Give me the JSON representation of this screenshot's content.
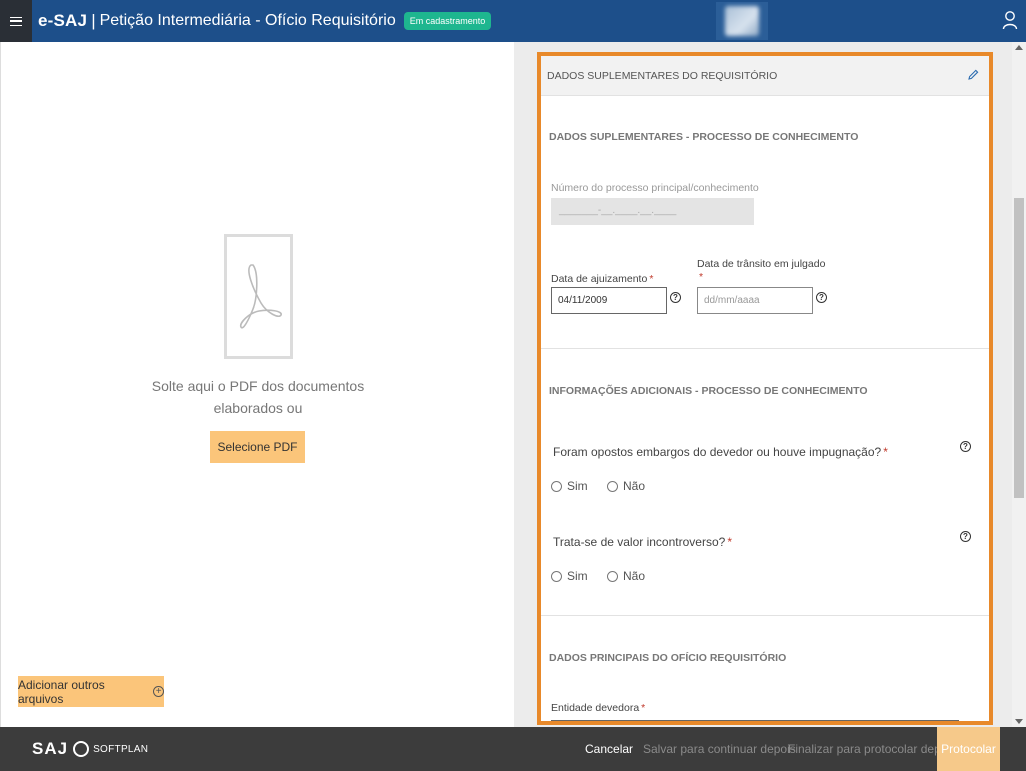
{
  "header": {
    "brand": "e-SAJ",
    "separator": "|",
    "title": "Petição Intermediária - Ofício Requisitório",
    "status_badge": "Em cadastramento"
  },
  "left": {
    "drop_text": "Solte aqui o PDF dos documentos elaborados ou",
    "select_pdf_label": "Selecione PDF",
    "add_files_label": "Adicionar outros arquivos"
  },
  "panel": {
    "title": "DADOS SUPLEMENTARES DO REQUISITÓRIO",
    "section1": {
      "title": "DADOS SUPLEMENTARES - PROCESSO DE CONHECIMENTO",
      "process_number_label": "Número do processo principal/conhecimento",
      "process_number_mask": "_______-__.____.__.____",
      "filing_date_label": "Data de ajuizamento",
      "filing_date_value": "04/11/2009",
      "res_judicata_label": "Data de trânsito em julgado",
      "res_judicata_placeholder": "dd/mm/aaaa",
      "required_mark": "*"
    },
    "section2": {
      "title": "INFORMAÇÕES ADICIONAIS - PROCESSO DE CONHECIMENTO",
      "q1": "Foram opostos embargos do devedor ou houve impugnação?",
      "q2": "Trata-se de valor incontroverso?",
      "yes": "Sim",
      "no": "Não"
    },
    "section3": {
      "title": "DADOS PRINCIPAIS DO OFÍCIO REQUISITÓRIO",
      "debtor_label": "Entidade devedora"
    }
  },
  "footer": {
    "logo_saj": "SAJ",
    "logo_softplan": "SOFTPLAN",
    "cancel": "Cancelar",
    "save": "Salvar para continuar depois",
    "finalize": "Finalizar para protocolar depois",
    "protocol": "Protocolar"
  },
  "colors": {
    "header_bg": "#1d4f8a",
    "badge": "#1eb68f",
    "highlight_border": "#e8892a",
    "button_orange": "#fbc57a",
    "footer_bg": "#3c3c3c"
  }
}
